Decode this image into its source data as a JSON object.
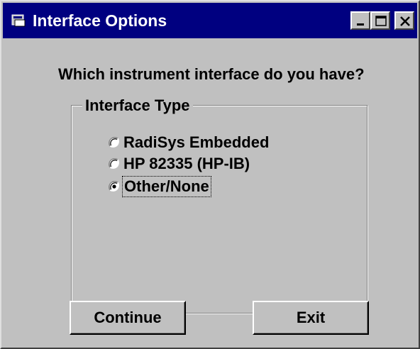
{
  "window": {
    "title": "Interface Options",
    "titlebar_color": "#000080",
    "face_color": "#c0c0c0",
    "controls": [
      "minimize-icon",
      "maximize-icon",
      "close-icon"
    ]
  },
  "dialog": {
    "question": "Which instrument interface do you have?",
    "group_label": "Interface Type",
    "options": [
      {
        "label": "RadiSys Embedded",
        "selected": false
      },
      {
        "label": "HP 82335 (HP-IB)",
        "selected": false
      },
      {
        "label": "Other/None",
        "selected": true
      }
    ],
    "continue_label": "Continue",
    "exit_label": "Exit"
  }
}
